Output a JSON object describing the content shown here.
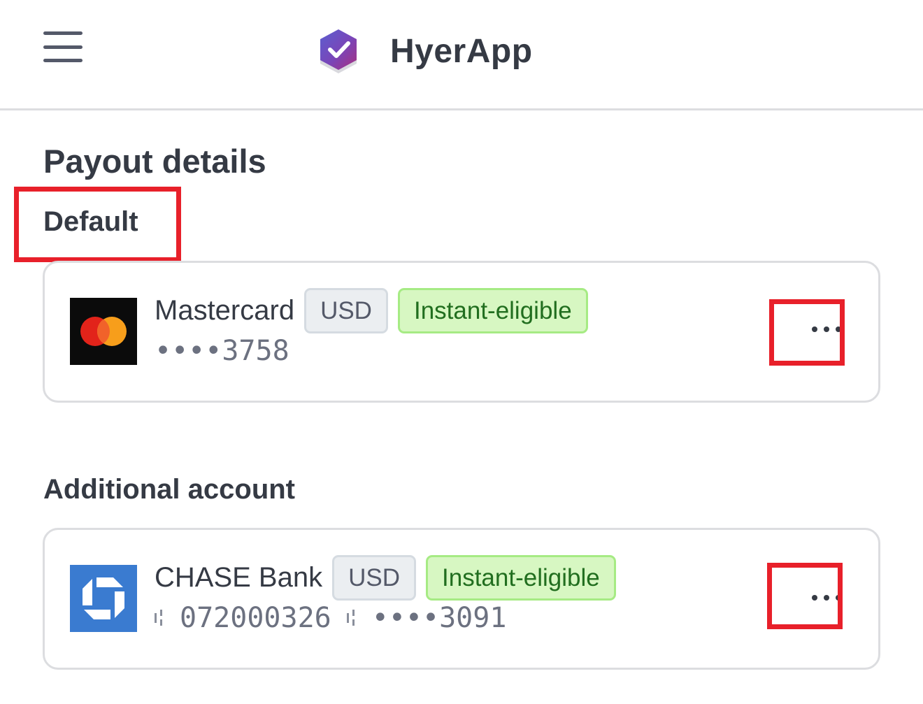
{
  "header": {
    "app_name": "HyerApp",
    "menu_icon": "hamburger-menu-icon",
    "logo_icon": "shield-check-logo"
  },
  "page": {
    "title": "Payout details"
  },
  "sections": {
    "default_label": "Default",
    "additional_label": "Additional account"
  },
  "accounts": [
    {
      "logo": "mastercard-logo",
      "name": "Mastercard",
      "currency": "USD",
      "status": "Instant-eligible",
      "masked": "••••3758",
      "more_icon": "more-horizontal-icon"
    },
    {
      "logo": "chase-bank-logo",
      "name": "CHASE Bank",
      "currency": "USD",
      "status": "Instant-eligible",
      "routing": "072000326",
      "masked": "••••3091",
      "more_icon": "more-horizontal-icon"
    }
  ],
  "colors": {
    "highlight": "#e8202a",
    "instant_bg": "#d7f7c2",
    "instant_text": "#216e1f",
    "currency_bg": "#ebeef1",
    "chase_blue": "#3a7bd0"
  }
}
